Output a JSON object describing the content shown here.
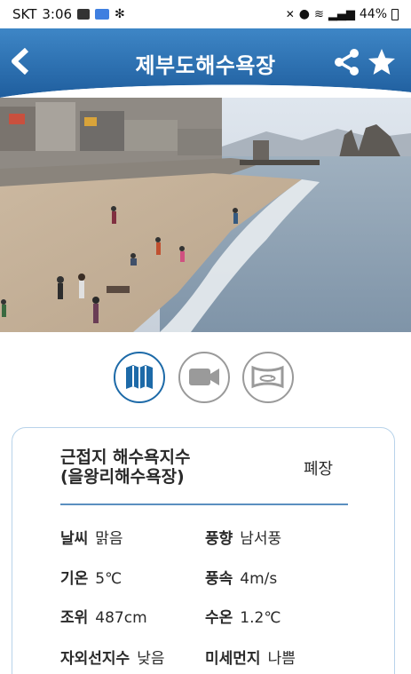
{
  "status_bar": {
    "carrier": "SKT",
    "time": "3:06",
    "battery": "44%"
  },
  "header": {
    "title": "제부도해수욕장",
    "accent_color": "#2f6fb0"
  },
  "view_buttons": [
    {
      "name": "map",
      "icon": "map-icon",
      "selected": true
    },
    {
      "name": "video",
      "icon": "video-camera-icon",
      "selected": false
    },
    {
      "name": "panorama",
      "icon": "panorama-360-icon",
      "selected": false
    }
  ],
  "info": {
    "nearest_label_line1": "근접지 해수욕지수",
    "nearest_label_line2": "(을왕리해수욕장)",
    "status": "폐장",
    "weather_label": "날씨",
    "weather_value": "맑음",
    "wind_dir_label": "풍향",
    "wind_dir_value": "남서풍",
    "temp_label": "기온",
    "temp_value": "5℃",
    "wind_speed_label": "풍속",
    "wind_speed_value": "4m/s",
    "tide_label": "조위",
    "tide_value": "487cm",
    "water_temp_label": "수온",
    "water_temp_value": "1.2℃",
    "uv_label": "자외선지수",
    "uv_value": "낮음",
    "dust_label": "미세먼지",
    "dust_value": "나쁨"
  }
}
